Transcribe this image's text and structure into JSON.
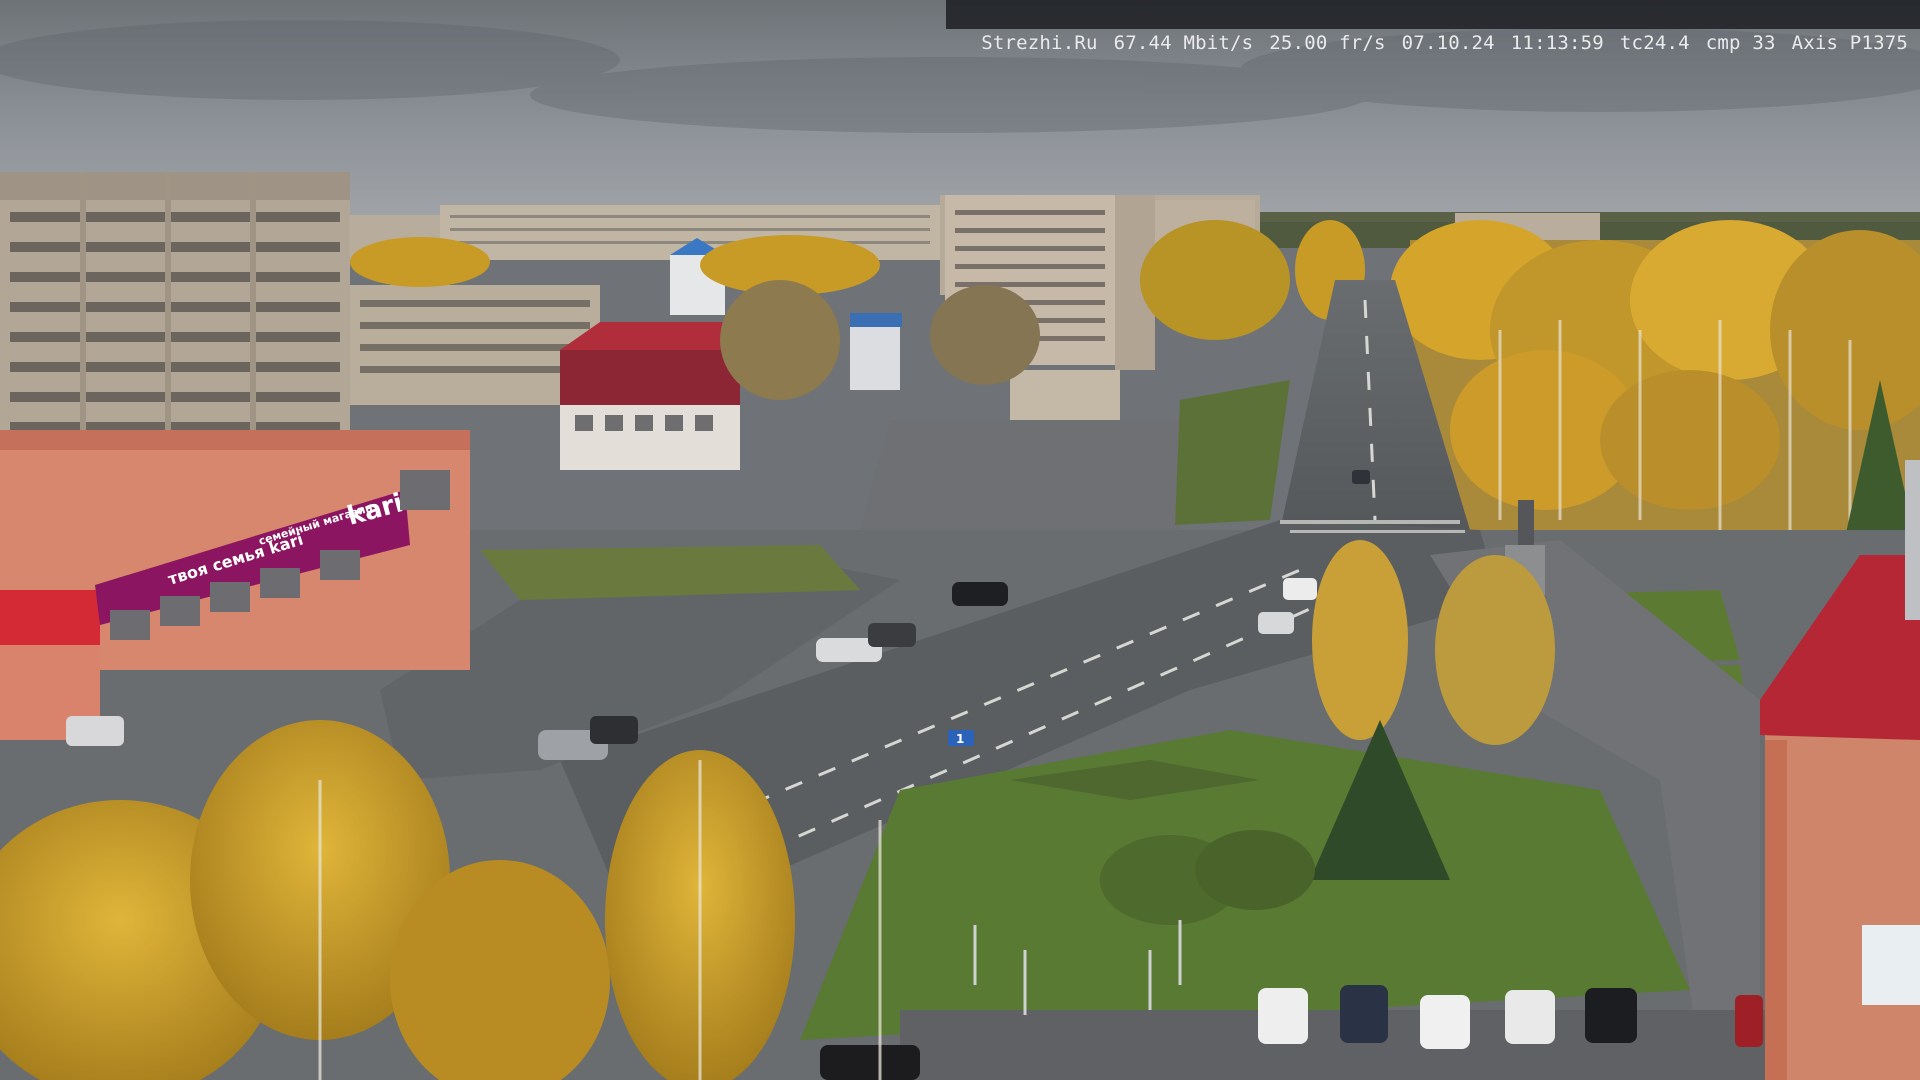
{
  "osd": {
    "site": "Strezhi.Ru",
    "bitrate": "67.44 Mbit/s",
    "framerate": "25.00 fr/s",
    "date": "07.10.24",
    "time": "11:13:59",
    "tc": "tc24.4",
    "cmp": "cmp 33",
    "camera": "Axis P1375"
  },
  "signs": {
    "store_name": "kari",
    "store_slogan": "твоя семья kari",
    "store_side": "семейный магазин",
    "road_sign": "1"
  },
  "colors": {
    "sky": "#8b9096",
    "road": "#5d6064",
    "foliage_gold": "#c9a02a",
    "kari_magenta": "#8b1560",
    "building_salmon": "#d98a72",
    "roof_red": "#b52734"
  }
}
